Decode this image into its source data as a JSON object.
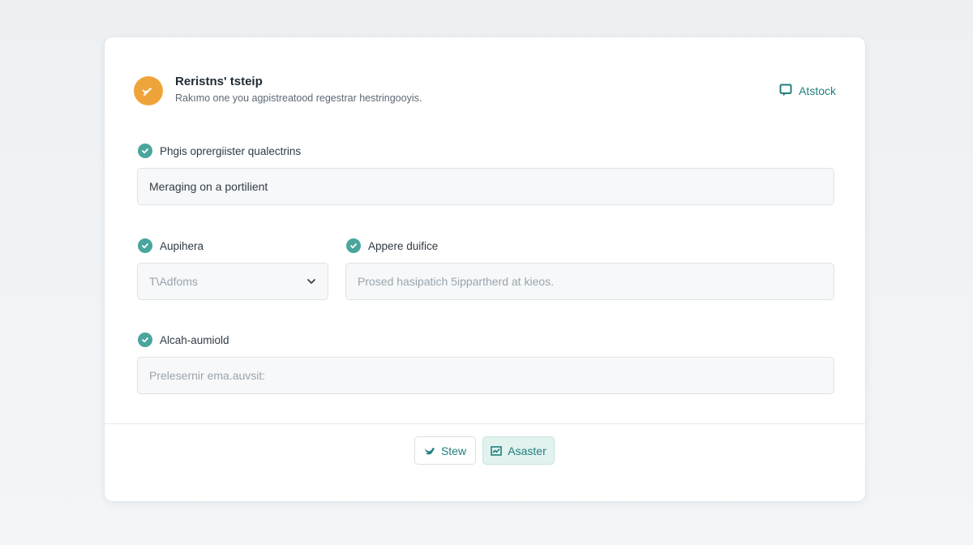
{
  "header": {
    "title": "Reristns' tsteip",
    "subtitle": "Rakımo one you agpistreatood regestrar hestringooyis.",
    "link_label": "Atstock"
  },
  "fields": {
    "field1": {
      "label": "Phgis oprergiister qualectrins",
      "value": "Meraging on a portilient"
    },
    "field2": {
      "label": "Aupihera",
      "value": "T\\Adfoms"
    },
    "field3": {
      "label": "Appere duifice",
      "placeholder": "Prosed hasipatich 5ippartherd at kieos."
    },
    "field4": {
      "label": "Alcah-aumiold",
      "placeholder": "Prelesernir ema.auvsit:"
    }
  },
  "footer": {
    "secondary_label": "Stew",
    "primary_label": "Asaster"
  },
  "colors": {
    "accent": "#1f7f7c",
    "check": "#4aa59c",
    "logo": "#efa43b"
  }
}
